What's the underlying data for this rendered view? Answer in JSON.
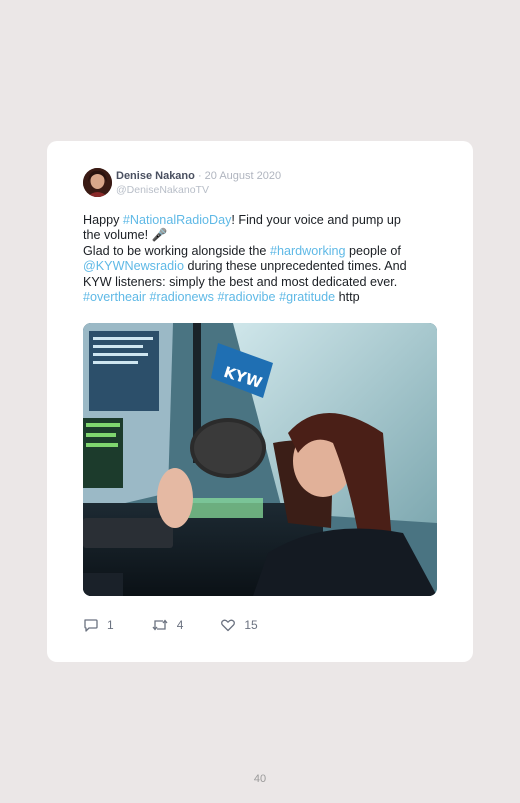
{
  "tweet": {
    "author": "Denise Nakano",
    "date": "· 20 August 2020",
    "handle": "@DeniseNakanoTV",
    "text": {
      "l1a": "Happy ",
      "l1tag": "#NationalRadioDay",
      "l1b": "! Find your voice and pump up",
      "l2": "the volume! 🎤",
      "l3a": "Glad to be working alongside the ",
      "l3tag": "#hardworking",
      "l3b": " people of",
      "l4tag": "@KYWNewsradio",
      "l4b": " during these unprecedented times. And",
      "l5": "KYW listeners: simply the best and most dedicated ever.",
      "l6tag1": "#overtheair",
      "l6tag2": "#radionews",
      "l6tag3": "#radiovibe",
      "l6tag4": "#gratitude",
      "l6end": "http"
    },
    "photo_logo": "kyw",
    "replies": "1",
    "retweets": "4",
    "likes": "15",
    "icons": [
      "reply-icon",
      "retweet-icon",
      "heart-icon"
    ]
  },
  "page_number": "40",
  "colors": {
    "background": "#ebe7e7",
    "card": "#ffffff",
    "hashtag": "#5fb9e6",
    "text": "#1b1f24"
  }
}
